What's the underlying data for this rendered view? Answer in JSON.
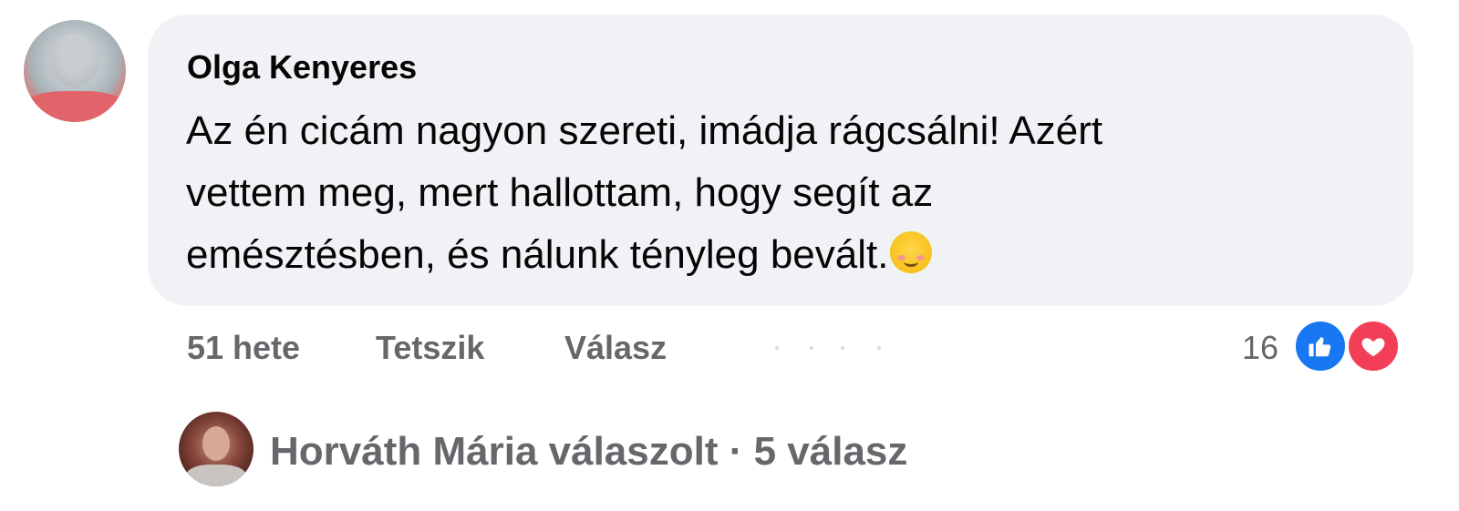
{
  "comment": {
    "author": "Olga Kenyeres",
    "text_lines": [
      "Az én cicám nagyon szereti, imádja rágcsálni! Azért",
      "vettem meg, mert hallottam, hogy segít az",
      "emésztésben, és nálunk tényleg bevált."
    ],
    "emoji": "smiling-face-with-smiling-eyes-icon",
    "bubble_color": "#f0f2f5"
  },
  "actions": {
    "time": "51 hete",
    "like_label": "Tetszik",
    "reply_label": "Válasz"
  },
  "reactions": {
    "count": "16",
    "types": [
      "like-icon",
      "love-icon"
    ],
    "like_color": "#1877f2",
    "love_color": "#f33e58"
  },
  "replies": {
    "text": "Horváth Mária válaszolt · 5 válasz"
  }
}
